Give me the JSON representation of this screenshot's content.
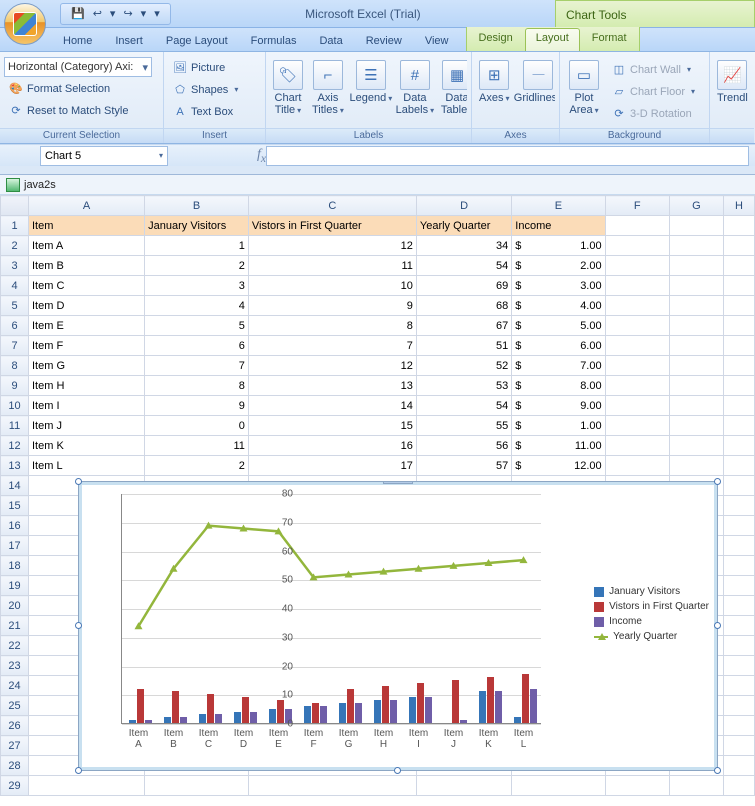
{
  "titlebar": {
    "app_title": "Microsoft Excel (Trial)",
    "chart_tools": "Chart Tools"
  },
  "qat": {
    "save": "💾",
    "undo": "↩",
    "redo": "↪"
  },
  "tabs": {
    "main": [
      "Home",
      "Insert",
      "Page Layout",
      "Formulas",
      "Data",
      "Review",
      "View"
    ],
    "ctx": [
      "Design",
      "Layout",
      "Format"
    ],
    "active": "Layout"
  },
  "ribbon": {
    "g1_title": "Current Selection",
    "g1_combo": "Horizontal (Category) Axi:",
    "g1_fmt": "Format Selection",
    "g1_reset": "Reset to Match Style",
    "g2_title": "Insert",
    "g2_pic": "Picture",
    "g2_shapes": "Shapes",
    "g2_text": "Text Box",
    "g3_title": "Labels",
    "g3_ct": "Chart\nTitle",
    "g3_at": "Axis\nTitles",
    "g3_lg": "Legend",
    "g3_dl": "Data\nLabels",
    "g3_dt": "Data\nTable",
    "g4_title": "Axes",
    "g4_ax": "Axes",
    "g4_gl": "Gridlines",
    "g5_title": "Background",
    "g5_pa": "Plot\nArea",
    "g5_cw": "Chart Wall",
    "g5_cf": "Chart Floor",
    "g5_3d": "3-D Rotation",
    "g6_tl": "Trendl"
  },
  "namebox": "Chart 5",
  "caption": "java2s",
  "headers": {
    "A": "Item",
    "B": "January Visitors",
    "C": "Vistors in First Quarter",
    "D": "Yearly Quarter",
    "E": "Income"
  },
  "cols": [
    "A",
    "B",
    "C",
    "D",
    "E",
    "F",
    "G",
    "H"
  ],
  "rows": [
    {
      "n": 1
    },
    {
      "n": 2,
      "A": "Item A",
      "B": "1",
      "C": "12",
      "D": "34",
      "E_s": "$",
      "E_v": "1.00"
    },
    {
      "n": 3,
      "A": "Item B",
      "B": "2",
      "C": "11",
      "D": "54",
      "E_s": "$",
      "E_v": "2.00"
    },
    {
      "n": 4,
      "A": "Item C",
      "B": "3",
      "C": "10",
      "D": "69",
      "E_s": "$",
      "E_v": "3.00"
    },
    {
      "n": 5,
      "A": "Item D",
      "B": "4",
      "C": "9",
      "D": "68",
      "E_s": "$",
      "E_v": "4.00"
    },
    {
      "n": 6,
      "A": "Item E",
      "B": "5",
      "C": "8",
      "D": "67",
      "E_s": "$",
      "E_v": "5.00"
    },
    {
      "n": 7,
      "A": "Item F",
      "B": "6",
      "C": "7",
      "D": "51",
      "E_s": "$",
      "E_v": "6.00"
    },
    {
      "n": 8,
      "A": "Item G",
      "B": "7",
      "C": "12",
      "D": "52",
      "E_s": "$",
      "E_v": "7.00"
    },
    {
      "n": 9,
      "A": "Item H",
      "B": "8",
      "C": "13",
      "D": "53",
      "E_s": "$",
      "E_v": "8.00"
    },
    {
      "n": 10,
      "A": "Item I",
      "B": "9",
      "C": "14",
      "D": "54",
      "E_s": "$",
      "E_v": "9.00"
    },
    {
      "n": 11,
      "A": "Item J",
      "B": "0",
      "C": "15",
      "D": "55",
      "E_s": "$",
      "E_v": "1.00"
    },
    {
      "n": 12,
      "A": "Item K",
      "B": "11",
      "C": "16",
      "D": "56",
      "E_s": "$",
      "E_v": "11.00"
    },
    {
      "n": 13,
      "A": "Item L",
      "B": "2",
      "C": "17",
      "D": "57",
      "E_s": "$",
      "E_v": "12.00"
    },
    {
      "n": 14
    },
    {
      "n": 15
    },
    {
      "n": 16
    },
    {
      "n": 17
    },
    {
      "n": 18
    },
    {
      "n": 19
    },
    {
      "n": 20
    },
    {
      "n": 21
    },
    {
      "n": 22
    },
    {
      "n": 23
    },
    {
      "n": 24
    },
    {
      "n": 25
    },
    {
      "n": 26
    },
    {
      "n": 27
    },
    {
      "n": 28
    },
    {
      "n": 29
    }
  ],
  "chart_data": {
    "type": "bar+line",
    "categories": [
      "Item A",
      "Item B",
      "Item C",
      "Item D",
      "Item E",
      "Item F",
      "Item G",
      "Item H",
      "Item I",
      "Item J",
      "Item K",
      "Item L"
    ],
    "series": [
      {
        "name": "January Visitors",
        "type": "bar",
        "color": "#3575b8",
        "values": [
          1,
          2,
          3,
          4,
          5,
          6,
          7,
          8,
          9,
          0,
          11,
          2
        ]
      },
      {
        "name": "Vistors in First Quarter",
        "type": "bar",
        "color": "#b93838",
        "values": [
          12,
          11,
          10,
          9,
          8,
          7,
          12,
          13,
          14,
          15,
          16,
          17
        ]
      },
      {
        "name": "Income",
        "type": "bar",
        "color": "#6f5ea8",
        "values": [
          1,
          2,
          3,
          4,
          5,
          6,
          7,
          8,
          9,
          1,
          11,
          12
        ]
      },
      {
        "name": "Yearly Quarter",
        "type": "line",
        "color": "#93b63c",
        "values": [
          34,
          54,
          69,
          68,
          67,
          51,
          52,
          53,
          54,
          55,
          56,
          57
        ]
      }
    ],
    "ylim": [
      0,
      80
    ],
    "yticks": [
      0,
      10,
      20,
      30,
      40,
      50,
      60,
      70,
      80
    ],
    "legend": [
      "January Visitors",
      "Vistors in First Quarter",
      "Income",
      "Yearly Quarter"
    ]
  }
}
